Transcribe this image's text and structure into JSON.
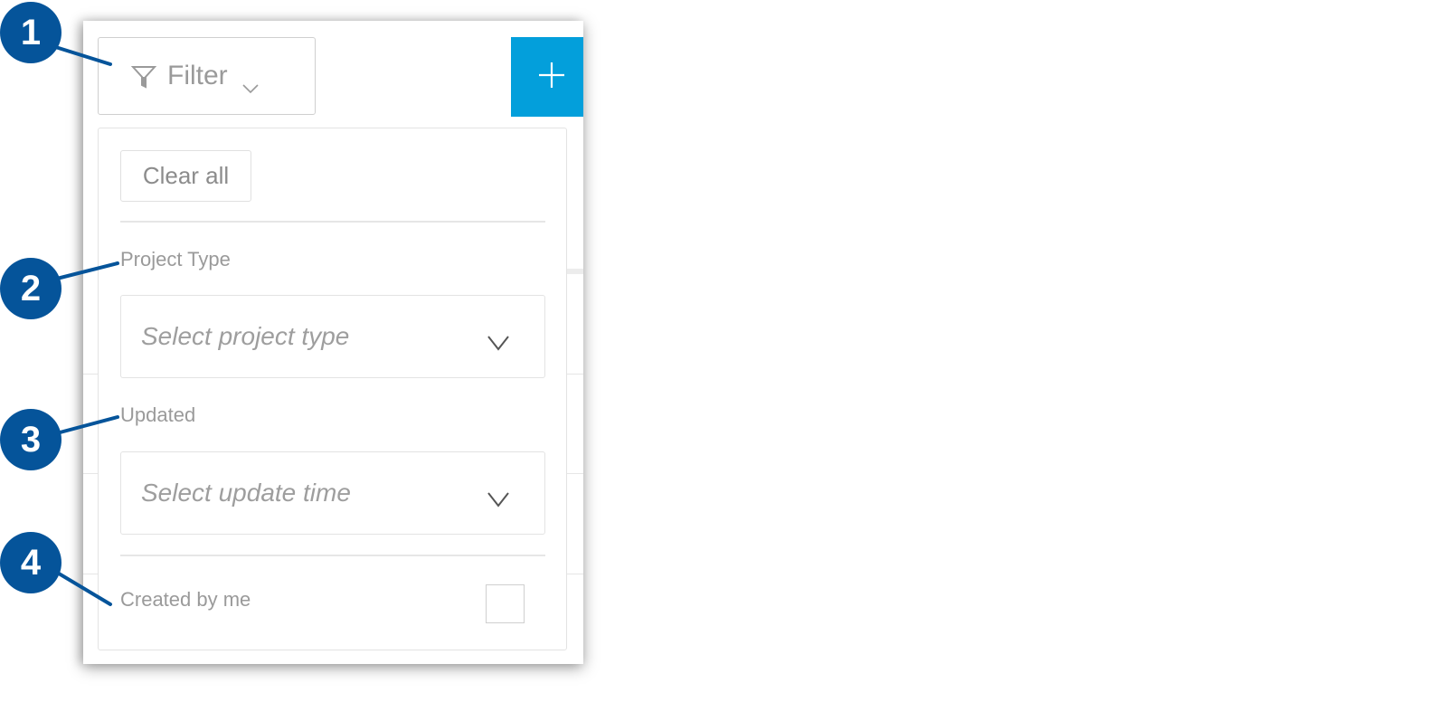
{
  "toolbar": {
    "filter_label": "Filter",
    "filter_icon": "funnel-icon",
    "filter_chevron_icon": "chevron-down-icon",
    "add_icon": "plus-icon",
    "add_color": "#039fdb"
  },
  "filter_panel": {
    "clear_all_label": "Clear all",
    "project_type": {
      "label": "Project Type",
      "placeholder": "Select project type"
    },
    "updated": {
      "label": "Updated",
      "placeholder": "Select update time"
    },
    "created_by_me": {
      "label": "Created by me",
      "checked": false
    }
  },
  "callouts": [
    {
      "number": "1",
      "target": "filter-button"
    },
    {
      "number": "2",
      "target": "project-type-label"
    },
    {
      "number": "3",
      "target": "updated-label"
    },
    {
      "number": "4",
      "target": "created-by-me-label"
    }
  ],
  "callout_color": "#05549a"
}
